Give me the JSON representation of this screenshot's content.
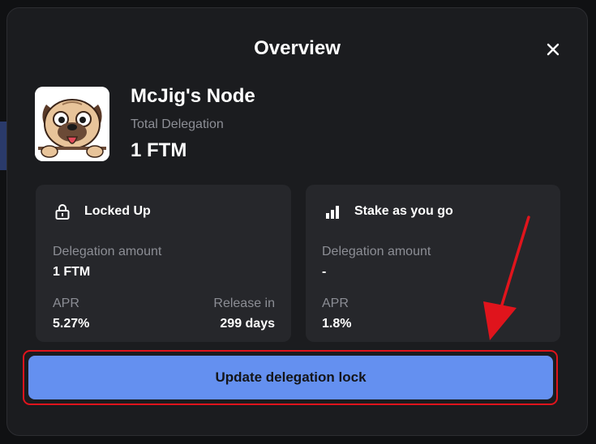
{
  "modal": {
    "title": "Overview"
  },
  "node": {
    "name": "McJig's Node",
    "total_delegation_label": "Total Delegation",
    "total_delegation_value": "1 FTM"
  },
  "locked_card": {
    "icon": "lock-icon",
    "title": "Locked Up",
    "delegation_label": "Delegation amount",
    "delegation_value": "1 FTM",
    "apr_label": "APR",
    "apr_value": "5.27%",
    "release_label": "Release in",
    "release_value": "299 days"
  },
  "stake_card": {
    "icon": "bar-chart-icon",
    "title": "Stake as you go",
    "delegation_label": "Delegation amount",
    "delegation_value": "-",
    "apr_label": "APR",
    "apr_value": "1.8%"
  },
  "actions": {
    "update_label": "Update delegation lock"
  },
  "colors": {
    "modal_bg": "#1b1c1f",
    "card_bg": "#26272b",
    "accent_button": "#6490f0",
    "highlight_red": "#e0141c",
    "muted_text": "#8c8e95"
  }
}
